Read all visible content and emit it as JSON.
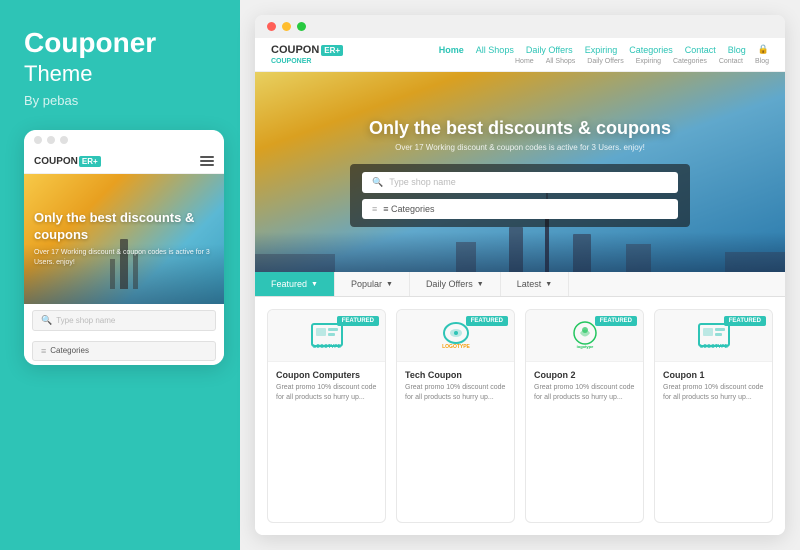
{
  "leftPanel": {
    "title": "Couponer",
    "subtitle": "Theme",
    "author": "By pebas"
  },
  "mobileMockup": {
    "logo": "COUPON",
    "logoAccent": "ER+",
    "heroText": "Only the best discounts & coupons",
    "heroSub": "Over 17 Working discount & coupon codes is active for 3 Users. enjoy!",
    "searchPlaceholder": "Type shop name",
    "categoriesLabel": "Categories"
  },
  "desktopMockup": {
    "titlebarDots": [
      "red",
      "yellow",
      "green"
    ],
    "navLogo": "COUPON",
    "navLogoAccent": "ER+",
    "navLogoSub": "COUPONER",
    "navLinks": [
      "Home",
      "All Shops",
      "Daily Offers",
      "Expiring",
      "Categories",
      "Contact",
      "Blog"
    ],
    "navLinksActive": "Home",
    "heroTitle": "Only the best discounts & coupons",
    "heroSubtitle": "Over 17 Working discount & coupon codes is active for 3 Users. enjoy!",
    "searchPlaceholder": "Type shop name",
    "categoriesLabel": "≡  Categories",
    "tabs": [
      {
        "label": "Featured",
        "active": true
      },
      {
        "label": "Popular",
        "active": false
      },
      {
        "label": "Daily Offers",
        "active": false
      },
      {
        "label": "Latest",
        "active": false
      }
    ],
    "cards": [
      {
        "id": 1,
        "logoText": "LOGOTYPE",
        "logoColor": "teal",
        "featured": true,
        "title": "Coupon Computers",
        "desc": "Great promo 10% discount code for all products so hurry up..."
      },
      {
        "id": 2,
        "logoText": "LOGOTYPE",
        "logoColor": "orange",
        "featured": true,
        "title": "Tech Coupon",
        "desc": "Great promo 10% discount code for all products so hurry up..."
      },
      {
        "id": 3,
        "logoText": "logotype",
        "logoColor": "green",
        "featured": true,
        "title": "Coupon 2",
        "desc": "Great promo 10% discount code for all products so hurry up..."
      },
      {
        "id": 4,
        "logoText": "LOGOTYPE",
        "logoColor": "teal",
        "featured": true,
        "title": "Coupon 1",
        "desc": "Great promo 10% discount code for all products so hurry up..."
      }
    ],
    "featuredBadgeLabel": "FEATURED"
  }
}
